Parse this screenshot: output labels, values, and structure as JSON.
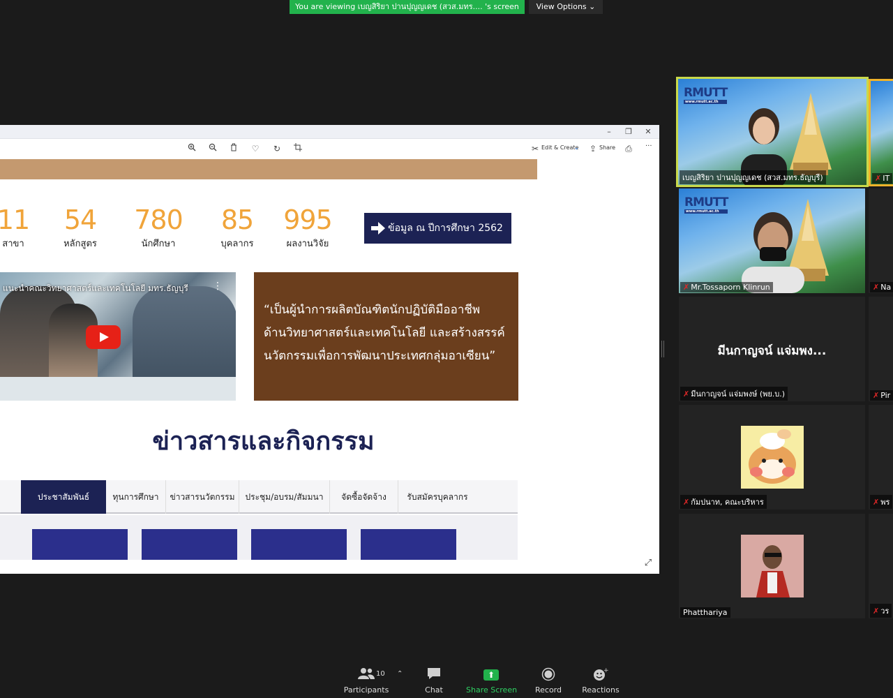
{
  "top_bar": {
    "viewing_banner": "You are viewing เบญสิริยา ปานปุญญเดช (สวส.มทร.... 's screen",
    "view_options": "View Options ⌄"
  },
  "window": {
    "controls": {
      "minimize": "–",
      "restore": "❐",
      "close": "✕"
    },
    "toolbar": {
      "edit_create": "Edit & Create",
      "share": "Share",
      "more": "···"
    }
  },
  "page": {
    "stats": [
      {
        "value": "11",
        "label": "สาขา"
      },
      {
        "value": "54",
        "label": "หลักสูตร"
      },
      {
        "value": "780",
        "label": "นักศึกษา"
      },
      {
        "value": "85",
        "label": "บุคลากร"
      },
      {
        "value": "995",
        "label": "ผลงานวิจัย"
      }
    ],
    "year_badge": "ข้อมูล ณ ปีการศึกษา 2562",
    "video_title": "แนะนำคณะวิทยาศาสตร์และเทคโนโลยี มทร.ธัญบุรี",
    "quote_lines": [
      "“เป็นผู้นำการผลิตบัณฑิตนักปฏิบัติมืออาชีพ",
      "ด้านวิทยาศาสตร์และเทคโนโลยี และสร้างสรรค์",
      "นวัตกรรมเพื่อการพัฒนาประเทศกลุ่มอาเซียน”"
    ],
    "news_heading": "ข่าวสารและกิจกรรม",
    "news_tabs": [
      "ประชาสัมพันธ์",
      "ทุนการศึกษา",
      "ข่าวสารนวัตกรรม",
      "ประชุม/อบรม/สัมมนา",
      "จัดซื้อจัดจ้าง",
      "รับสมัครบุคลากร"
    ],
    "colors": {
      "accent_navy": "#1c2254",
      "stat_orange": "#f0a43a",
      "quote_brown": "#6b3e1d",
      "banner_tan": "#c4996f"
    }
  },
  "gallery": {
    "logo_text": "RMUTT",
    "tiles": [
      {
        "name": "เบญสิริยา ปานปุญญเดช (สวส.มทร.ธัญบุรี)",
        "muted": false,
        "active_speaker": true
      },
      {
        "name": "Mr.Tossaporn Klinrun",
        "muted": true
      },
      {
        "name": "มีนกาญจน์ แจ่มพงษ์ (พย.บ.)",
        "muted": true,
        "big_name": "มีนกาญจน์ แจ่มพง..."
      },
      {
        "name": "กัมปนาท, คณะบริหาร",
        "muted": true
      },
      {
        "name": "Phatthariya",
        "muted": false
      }
    ],
    "side_tiles": [
      "IT",
      "Na",
      "Pir",
      "พร",
      "วร"
    ]
  },
  "bottom_bar": {
    "participants": {
      "label": "Participants",
      "count": "10"
    },
    "chat": "Chat",
    "share_screen": "Share Screen",
    "record": "Record",
    "reactions": "Reactions",
    "colors": {
      "share_green": "#22b24c"
    }
  }
}
